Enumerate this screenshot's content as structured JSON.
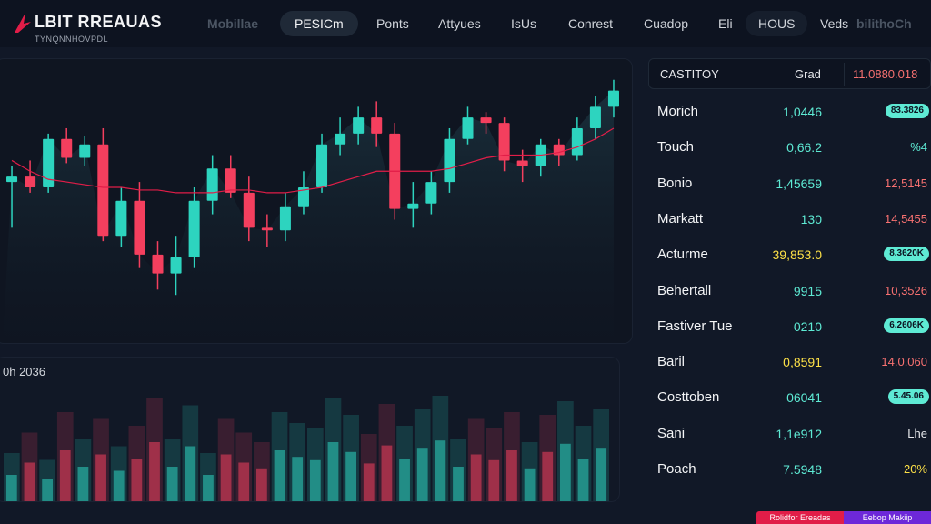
{
  "brand": {
    "title": "LBIT RREAUAS",
    "subtitle": "TYNQNNHOVPDL",
    "accent": "#e11d48"
  },
  "nav": {
    "items": [
      {
        "label": "Mobillae",
        "style": "dim"
      },
      {
        "label": "PESICm",
        "style": "active"
      },
      {
        "label": "Ponts",
        "style": "normal"
      },
      {
        "label": "Attyues",
        "style": "normal"
      },
      {
        "label": "IsUs",
        "style": "normal"
      },
      {
        "label": "Conrest",
        "style": "normal"
      },
      {
        "label": "Cuadop",
        "style": "normal"
      },
      {
        "label": "Eli",
        "style": "normal"
      },
      {
        "label": "HOUS",
        "style": "pill"
      },
      {
        "label": "Veds",
        "style": "normal"
      },
      {
        "label": "bilithoCh",
        "style": "dim"
      }
    ]
  },
  "chart": {
    "colors": {
      "up": "#2dd4bf",
      "down": "#f43f5e",
      "ma": "#e11d48"
    }
  },
  "chart_data": {
    "type": "candlestick",
    "candles": [
      [
        62,
        64,
        45,
        68
      ],
      [
        64,
        60,
        58,
        70
      ],
      [
        60,
        78,
        58,
        80
      ],
      [
        78,
        71,
        69,
        82
      ],
      [
        71,
        76,
        68,
        79
      ],
      [
        76,
        42,
        40,
        82
      ],
      [
        42,
        55,
        38,
        60
      ],
      [
        55,
        35,
        30,
        62
      ],
      [
        35,
        28,
        22,
        40
      ],
      [
        28,
        34,
        20,
        42
      ],
      [
        34,
        55,
        30,
        60
      ],
      [
        55,
        67,
        50,
        72
      ],
      [
        67,
        58,
        56,
        72
      ],
      [
        58,
        45,
        40,
        64
      ],
      [
        45,
        44,
        38,
        50
      ],
      [
        44,
        53,
        40,
        58
      ],
      [
        53,
        60,
        50,
        66
      ],
      [
        60,
        76,
        58,
        80
      ],
      [
        76,
        80,
        72,
        86
      ],
      [
        80,
        86,
        76,
        90
      ],
      [
        86,
        80,
        75,
        92
      ],
      [
        80,
        52,
        48,
        84
      ],
      [
        52,
        54,
        45,
        62
      ],
      [
        54,
        62,
        50,
        66
      ],
      [
        62,
        78,
        58,
        82
      ],
      [
        78,
        86,
        76,
        90
      ],
      [
        86,
        84,
        80,
        88
      ],
      [
        84,
        70,
        66,
        86
      ],
      [
        70,
        68,
        62,
        74
      ],
      [
        68,
        76,
        64,
        78
      ],
      [
        76,
        72,
        68,
        78
      ],
      [
        72,
        82,
        70,
        86
      ],
      [
        82,
        90,
        78,
        94
      ],
      [
        90,
        96,
        86,
        100
      ]
    ],
    "volumes": [
      30,
      45,
      25,
      60,
      40,
      55,
      35,
      50,
      70,
      40,
      65,
      30,
      55,
      45,
      38,
      60,
      52,
      48,
      70,
      58,
      44,
      66,
      50,
      62,
      72,
      40,
      55,
      48,
      60,
      38,
      58,
      68,
      50,
      62
    ],
    "moving_average": [
      70,
      66,
      63,
      62,
      61,
      60,
      60,
      59,
      59,
      58,
      58,
      58,
      59,
      59,
      58,
      58,
      59,
      60,
      62,
      64,
      66,
      66,
      66,
      66,
      67,
      69,
      71,
      72,
      72,
      72,
      73,
      75,
      78,
      82
    ]
  },
  "volume": {
    "label": "0h 2036"
  },
  "table": {
    "header": {
      "col1": "CASTITOY",
      "col2": "Grad",
      "col3": "11.0880.018"
    },
    "rows": [
      {
        "name": "Morich",
        "value": "1,0446",
        "value_color": "teal",
        "change": "83.3826",
        "change_type": "badge"
      },
      {
        "name": "Touch",
        "value": "0,66.2",
        "value_color": "teal",
        "change": "%4",
        "change_type": "teal"
      },
      {
        "name": "Bonio",
        "value": "1,45659",
        "value_color": "teal",
        "change": "12,5145",
        "change_type": "red"
      },
      {
        "name": "Markatt",
        "value": "130",
        "value_color": "teal",
        "change": "14,5455",
        "change_type": "red"
      },
      {
        "name": "Acturme",
        "value": "39,853.0",
        "value_color": "yellow",
        "change": "8.3620K",
        "change_type": "badge"
      },
      {
        "name": "Behertall",
        "value": "9915",
        "value_color": "teal",
        "change": "10,3526",
        "change_type": "red"
      },
      {
        "name": "Fastiver Tue",
        "value": "0210",
        "value_color": "teal",
        "change": "6.2606K",
        "change_type": "badge"
      },
      {
        "name": "Baril",
        "value": "0,8591",
        "value_color": "yellow",
        "change": "14.0.060",
        "change_type": "red"
      },
      {
        "name": "Costtoben",
        "value": "06041",
        "value_color": "teal",
        "change": "5.45.06",
        "change_type": "badge"
      },
      {
        "name": "Sani",
        "value": "1,1e912",
        "value_color": "teal",
        "change": "Lhe",
        "change_type": "white"
      },
      {
        "name": "Poach",
        "value": "7.5948",
        "value_color": "teal",
        "change": "20%",
        "change_type": "yellow"
      }
    ]
  },
  "footer": {
    "btn_a": "Rolidfor Ereadas",
    "btn_b": "Eebop Makiip"
  }
}
